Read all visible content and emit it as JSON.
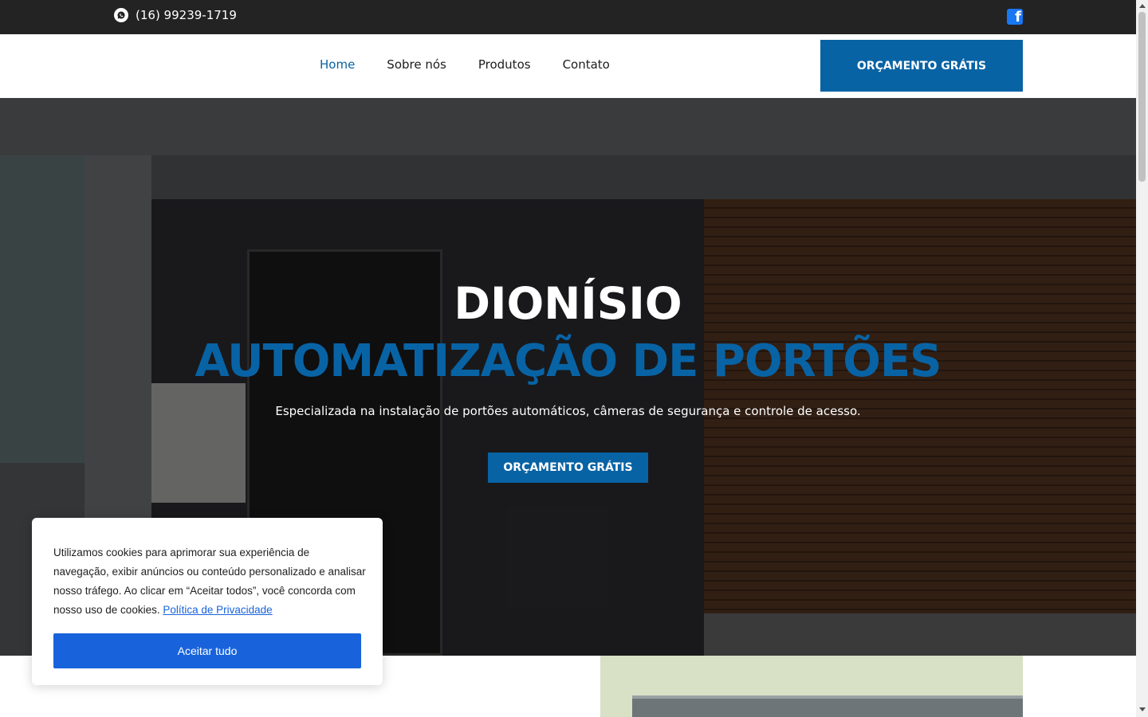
{
  "topbar": {
    "phone": "(16) 99239-1719",
    "whatsapp_icon": "whatsapp-icon",
    "facebook_icon": "facebook-icon",
    "facebook_glyph": "f"
  },
  "nav": {
    "items": [
      {
        "label": "Home",
        "active": true
      },
      {
        "label": "Sobre nós",
        "active": false
      },
      {
        "label": "Produtos",
        "active": false
      },
      {
        "label": "Contato",
        "active": false
      }
    ],
    "cta": "ORÇAMENTO GRÁTIS"
  },
  "hero": {
    "title": "DIONÍSIO",
    "subtitle": "AUTOMATIZAÇÃO DE PORTÕES",
    "description": "Especializada na instalação de portões automáticos, câmeras de segurança e controle de acesso.",
    "cta": "ORÇAMENTO GRÁTIS"
  },
  "cookie": {
    "text": "Utilizamos cookies para aprimorar sua experiência de navegação, exibir anúncios ou conteúdo personalizado e analisar nosso tráfego. Ao clicar em “Aceitar todos”, você concorda com nosso uso de cookies.",
    "policy_link": "Política de Privacidade",
    "accept": "Aceitar tudo"
  },
  "colors": {
    "brand_blue": "#0863a5",
    "topbar_bg": "#232323",
    "cookie_button": "#1863dc",
    "facebook": "#1877f2"
  }
}
